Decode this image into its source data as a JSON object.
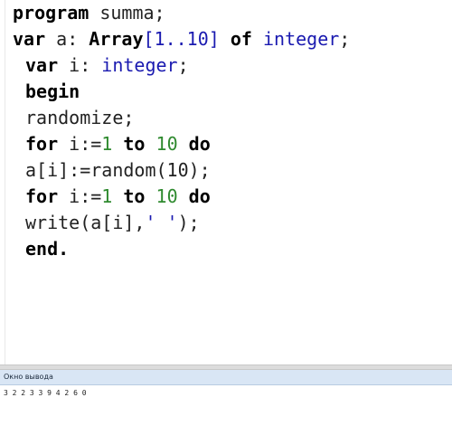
{
  "editor": {
    "lines": [
      {
        "indent": false,
        "tokens": [
          {
            "t": "kw",
            "v": "program"
          },
          {
            "t": "id",
            "v": " summa;"
          }
        ]
      },
      {
        "indent": false,
        "tokens": [
          {
            "t": "kw",
            "v": "var"
          },
          {
            "t": "id",
            "v": " a: "
          },
          {
            "t": "kw",
            "v": "Array"
          },
          {
            "t": "tp",
            "v": "[1..10]"
          },
          {
            "t": "id",
            "v": " "
          },
          {
            "t": "kw",
            "v": "of"
          },
          {
            "t": "id",
            "v": " "
          },
          {
            "t": "tp",
            "v": "integer"
          },
          {
            "t": "id",
            "v": ";"
          }
        ]
      },
      {
        "indent": true,
        "tokens": [
          {
            "t": "kw",
            "v": "var"
          },
          {
            "t": "id",
            "v": " i: "
          },
          {
            "t": "tp",
            "v": "integer"
          },
          {
            "t": "id",
            "v": ";"
          }
        ]
      },
      {
        "indent": true,
        "tokens": [
          {
            "t": "kw",
            "v": "begin"
          }
        ]
      },
      {
        "indent": true,
        "tokens": [
          {
            "t": "id",
            "v": "randomize;"
          }
        ]
      },
      {
        "indent": true,
        "tokens": [
          {
            "t": "kw",
            "v": "for"
          },
          {
            "t": "id",
            "v": " i:="
          },
          {
            "t": "num",
            "v": "1"
          },
          {
            "t": "id",
            "v": " "
          },
          {
            "t": "kw",
            "v": "to"
          },
          {
            "t": "id",
            "v": " "
          },
          {
            "t": "num",
            "v": "10"
          },
          {
            "t": "id",
            "v": " "
          },
          {
            "t": "kw",
            "v": "do"
          }
        ]
      },
      {
        "indent": true,
        "tokens": [
          {
            "t": "id",
            "v": "a[i]:=random(10);"
          }
        ]
      },
      {
        "indent": true,
        "tokens": [
          {
            "t": "kw",
            "v": "for"
          },
          {
            "t": "id",
            "v": " i:="
          },
          {
            "t": "num",
            "v": "1"
          },
          {
            "t": "id",
            "v": " "
          },
          {
            "t": "kw",
            "v": "to"
          },
          {
            "t": "id",
            "v": " "
          },
          {
            "t": "num",
            "v": "10"
          },
          {
            "t": "id",
            "v": " "
          },
          {
            "t": "kw",
            "v": "do"
          }
        ]
      },
      {
        "indent": true,
        "tokens": [
          {
            "t": "id",
            "v": "write(a[i],"
          },
          {
            "t": "str",
            "v": "' '"
          },
          {
            "t": "id",
            "v": ");"
          }
        ]
      },
      {
        "indent": true,
        "tokens": [
          {
            "t": "kw",
            "v": "end."
          }
        ]
      }
    ]
  },
  "output": {
    "title": "Окно вывода",
    "text": "3 2 2 3 3 9 4 2 6 0"
  },
  "colors": {
    "keyword": "#000000",
    "type": "#1a1ab0",
    "number": "#2f8a2f",
    "string": "#1a1ab0",
    "output_header_bg": "#d9e6f5"
  }
}
